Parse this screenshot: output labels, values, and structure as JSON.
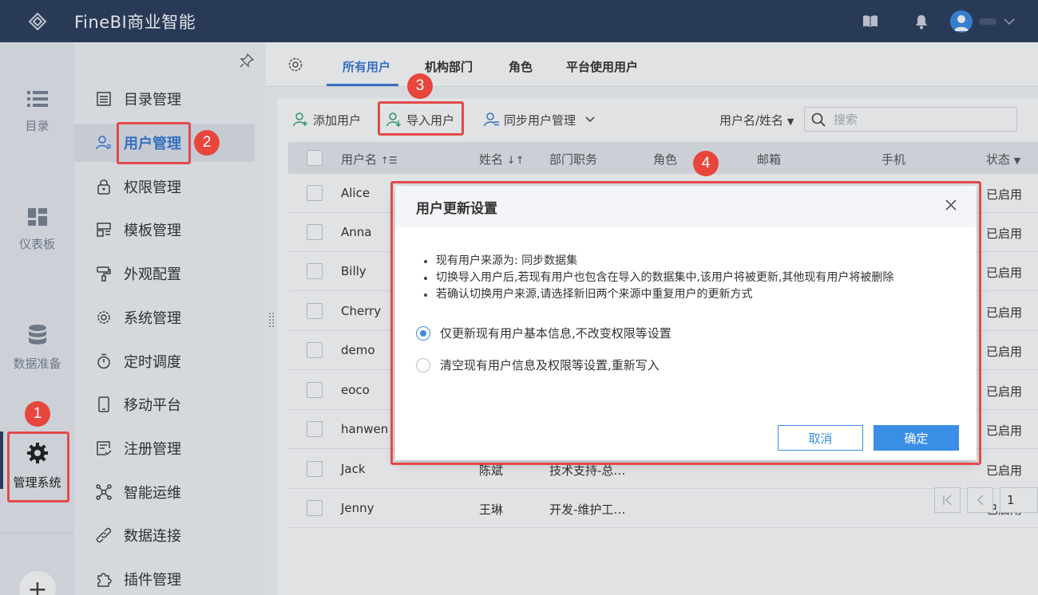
{
  "app": {
    "title": "FineBI商业智能"
  },
  "rail": {
    "items": [
      {
        "label": "目录",
        "icon": "list-icon"
      },
      {
        "label": "仪表板",
        "icon": "dashboard-icon"
      },
      {
        "label": "数据准备",
        "icon": "database-icon"
      },
      {
        "label": "管理系统",
        "icon": "gear-icon"
      }
    ],
    "plus": "+"
  },
  "subnav": {
    "items": [
      {
        "label": "目录管理",
        "icon": "catalog-icon"
      },
      {
        "label": "用户管理",
        "icon": "user-icon"
      },
      {
        "label": "权限管理",
        "icon": "lock-icon"
      },
      {
        "label": "模板管理",
        "icon": "template-icon"
      },
      {
        "label": "外观配置",
        "icon": "brush-icon"
      },
      {
        "label": "系统管理",
        "icon": "settings-icon"
      },
      {
        "label": "定时调度",
        "icon": "timer-icon"
      },
      {
        "label": "移动平台",
        "icon": "mobile-icon"
      },
      {
        "label": "注册管理",
        "icon": "register-icon"
      },
      {
        "label": "智能运维",
        "icon": "ops-icon"
      },
      {
        "label": "数据连接",
        "icon": "link-icon"
      },
      {
        "label": "插件管理",
        "icon": "plugin-icon"
      }
    ]
  },
  "tabs": [
    "所有用户",
    "机构部门",
    "角色",
    "平台使用用户"
  ],
  "toolbar": {
    "add_user": "添加用户",
    "import_user": "导入用户",
    "sync_user": "同步用户管理",
    "filter_label": "用户名/姓名",
    "search_placeholder": "搜索"
  },
  "table": {
    "columns": [
      "用户名",
      "姓名",
      "部门职务",
      "角色",
      "邮箱",
      "手机",
      "状态"
    ],
    "rows": [
      {
        "username": "Alice",
        "name": "",
        "dept": "",
        "status": "已启用"
      },
      {
        "username": "Anna",
        "name": "",
        "dept": "",
        "status": "已启用"
      },
      {
        "username": "Billy",
        "name": "",
        "dept": "",
        "status": "已启用"
      },
      {
        "username": "Cherry",
        "name": "",
        "dept": "",
        "status": "已启用"
      },
      {
        "username": "demo",
        "name": "",
        "dept": "",
        "status": "已启用"
      },
      {
        "username": "eoco",
        "name": "",
        "dept": "",
        "status": "已启用"
      },
      {
        "username": "hanwen",
        "name": "",
        "dept": "",
        "status": "已启用"
      },
      {
        "username": "Jack",
        "name": "陈斌",
        "dept": "技术支持-总…",
        "status": "已启用"
      },
      {
        "username": "Jenny",
        "name": "王琳",
        "dept": "开发-维护工…",
        "status": "已启用"
      }
    ]
  },
  "pager": {
    "page": "1"
  },
  "dialog": {
    "title": "用户更新设置",
    "notes": [
      "现有用户来源为: 同步数据集",
      "切换导入用户后,若现有用户也包含在导入的数据集中,该用户将被更新,其他现有用户将被删除",
      "若确认切换用户来源,请选择新旧两个来源中重复用户的更新方式"
    ],
    "options": [
      {
        "label": "仅更新现有用户基本信息,不改变权限等设置",
        "selected": true
      },
      {
        "label": "清空现有用户信息及权限等设置,重新写入",
        "selected": false
      }
    ],
    "cancel": "取消",
    "confirm": "确定"
  },
  "annotations": [
    "1",
    "2",
    "3",
    "4"
  ],
  "colors": {
    "topbar": "#2c3e5c",
    "accent": "#3a7bd5",
    "primary_button": "#3a8ee6",
    "annotation": "#e24a4a"
  }
}
